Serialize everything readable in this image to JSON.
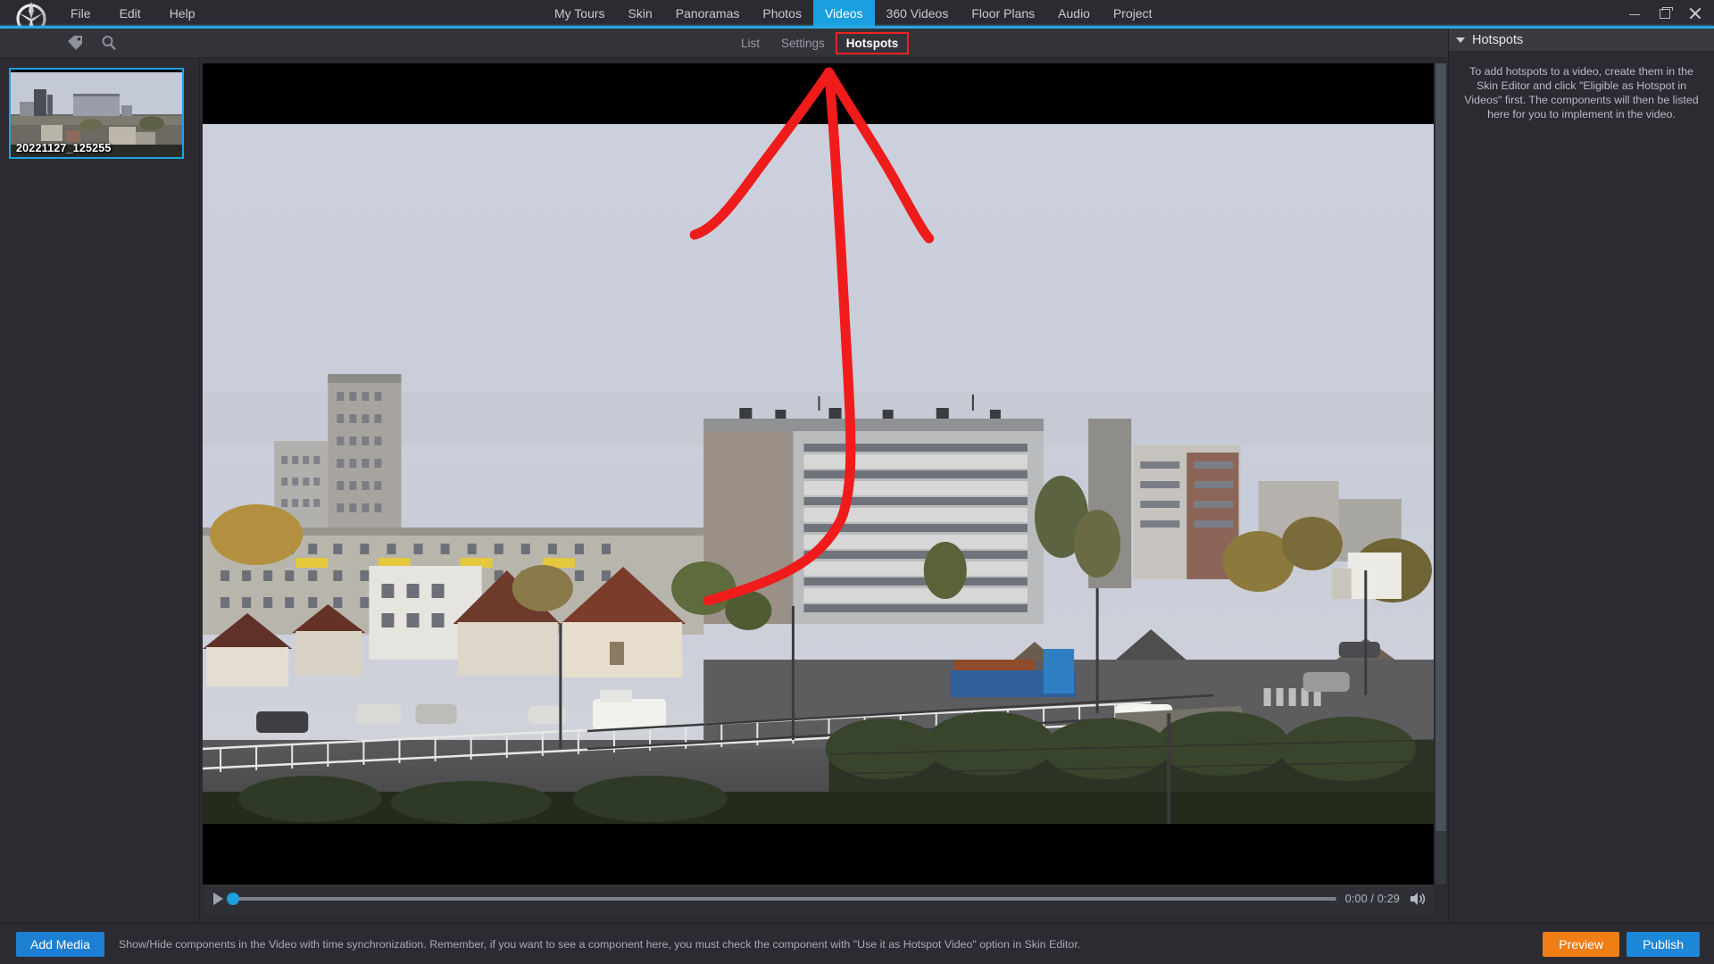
{
  "app": {
    "logo_icon": "pano2vr-logo-icon",
    "accent_color": "#2aa6e0"
  },
  "menubar": {
    "items": [
      {
        "label": "File"
      },
      {
        "label": "Edit"
      },
      {
        "label": "Help"
      }
    ]
  },
  "window_controls": {
    "minimize": "minimize-icon",
    "maximize": "restore-icon",
    "close": "close-icon"
  },
  "main_tabs": {
    "items": [
      {
        "label": "My Tours",
        "active": false
      },
      {
        "label": "Skin",
        "active": false
      },
      {
        "label": "Panoramas",
        "active": false
      },
      {
        "label": "Photos",
        "active": false
      },
      {
        "label": "Videos",
        "active": true
      },
      {
        "label": "360 Videos",
        "active": false
      },
      {
        "label": "Floor Plans",
        "active": false
      },
      {
        "label": "Audio",
        "active": false
      },
      {
        "label": "Project",
        "active": false
      }
    ],
    "active_color": "#1a9fe0"
  },
  "toolbar": {
    "icons": [
      {
        "name": "tag-icon"
      },
      {
        "name": "search-icon"
      }
    ]
  },
  "sub_tabs": {
    "items": [
      {
        "label": "List",
        "active": false
      },
      {
        "label": "Settings",
        "active": false
      },
      {
        "label": "Hotspots",
        "active": true
      }
    ],
    "highlight_color": "#ee2222"
  },
  "sidebar": {
    "media_items": [
      {
        "label": "20221127_125255",
        "selected": true
      }
    ],
    "selection_color": "#22a1e2"
  },
  "player": {
    "play_icon": "play-icon",
    "volume_icon": "volume-icon",
    "time_display": "0:00 / 0:29",
    "progress_percent": 0
  },
  "annotation": {
    "type": "hand-drawn-arrow",
    "color": "#f01b1b",
    "direction": "up",
    "description": "red freehand arrow pointing up toward Hotspots tab"
  },
  "right_panel": {
    "title": "Hotspots",
    "collapse_icon": "chevron-down-icon",
    "empty_message": "To add hotspots to a video, create them in the Skin Editor and click \"Eligible as Hotspot in Videos\" first. The components will then be listed here for you to implement in the video."
  },
  "bottom_bar": {
    "add_media_label": "Add Media",
    "status_text": "Show/Hide components in the Video with time synchronization. Remember, if you want to see a component here, you must check the component with \"Use it as Hotspot Video\" option in Skin Editor.",
    "preview_label": "Preview",
    "publish_label": "Publish",
    "preview_color": "#ef7e16",
    "publish_color": "#1d87d8",
    "add_media_color": "#1d7fd1"
  }
}
